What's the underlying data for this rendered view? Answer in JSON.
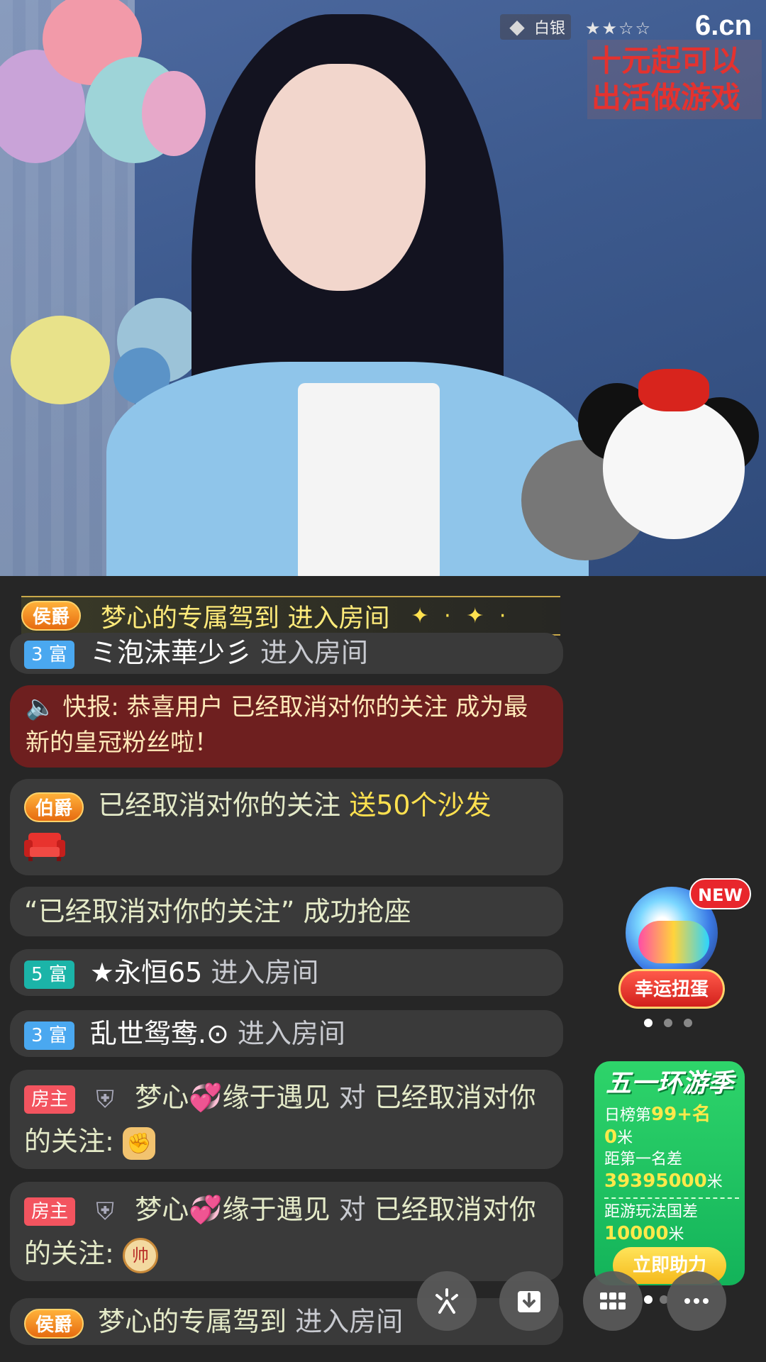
{
  "video": {
    "anchor_level_label": "白银",
    "anchor_stars": "★★☆☆",
    "site_logo": "6.cn",
    "overlay_text": "十元起可以出活做游戏"
  },
  "chat": {
    "banner": {
      "noble": "侯爵",
      "text": "梦心的专属驾到 进入房间",
      "sparkle": "✦ · ✦ ·"
    },
    "row1": {
      "fu": "3 富",
      "name": "ミ泡沫華少彡",
      "action": "进入房间"
    },
    "news": {
      "text": "快报: 恭喜用户 已经取消对你的关注 成为最新的皇冠粉丝啦！"
    },
    "gift": {
      "noble": "伯爵",
      "user": "已经取消对你的关注",
      "action": "送50个沙发"
    },
    "seat": {
      "text": "“已经取消对你的关注” 成功抢座"
    },
    "row4": {
      "fu": "5 富",
      "name": "★永恒65",
      "action": "进入房间"
    },
    "row5": {
      "fu": "3 富",
      "name": "乱世鸳鸯.⊙",
      "action": "进入房间"
    },
    "row6": {
      "host": "房主",
      "name": "梦心💞缘于遇见",
      "to": "对",
      "target": "已经取消对你的关注:",
      "emoji": "✊"
    },
    "row7": {
      "host": "房主",
      "name": "梦心💞缘于遇见",
      "to": "对",
      "target": "已经取消对你的关注:",
      "emoji": "帅"
    },
    "row8": {
      "noble": "侯爵",
      "name": "梦心的专属驾到",
      "action": "进入房间"
    }
  },
  "widgets": {
    "gacha": {
      "new": "NEW",
      "label": "幸运扭蛋"
    },
    "event": {
      "title": "五一环游季",
      "rank_prefix": "日榜第",
      "rank_value": "99+名",
      "distance_value": "0",
      "unit": "米",
      "gap_first_label": "距第一名差",
      "gap_first_value": "39395000",
      "gap_country_label": "距游玩法国差",
      "gap_country_value": "10000",
      "button": "立即助力"
    }
  },
  "colors": {
    "accent_yellow": "#ffe14f",
    "news_bg": "#6e1f1f",
    "event_green": "#2ed46a"
  }
}
